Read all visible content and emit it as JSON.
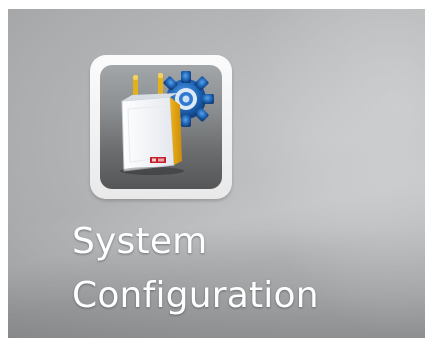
{
  "desktop": {
    "shortcuts": [
      {
        "icon": "system-configuration-icon",
        "label_line1": "System",
        "label_line2": "Configuration"
      }
    ]
  },
  "colors": {
    "label_text": "#ffffff",
    "gear_blue": "#1f66b8",
    "pole_yellow": "#e3b21b",
    "badge_red": "#c8202a"
  }
}
